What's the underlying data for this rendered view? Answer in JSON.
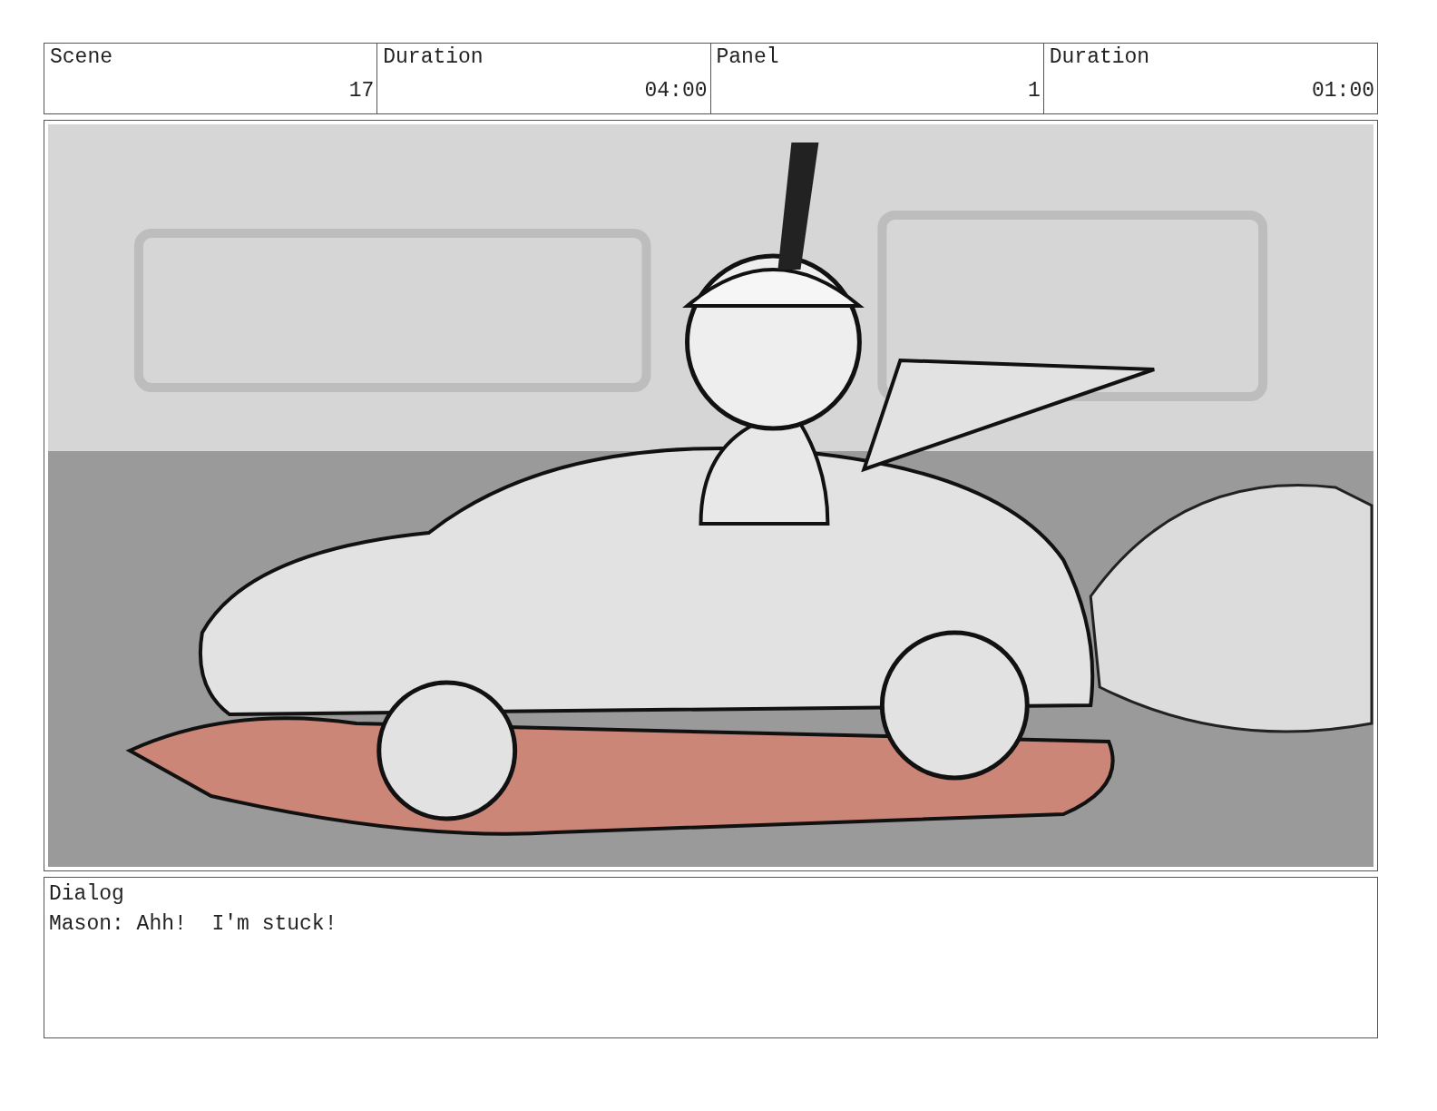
{
  "header_cells": [
    {
      "lines": [
        "Scene",
        "17"
      ]
    },
    {
      "lines": [
        "Duration",
        "04:00"
      ]
    },
    {
      "lines": [
        "Panel",
        "1"
      ]
    },
    {
      "lines": [
        "Duration",
        "01:00"
      ]
    }
  ],
  "dialog": {
    "label": "Dialog",
    "text": "Mason: Ahh!  I'm stuck!"
  }
}
